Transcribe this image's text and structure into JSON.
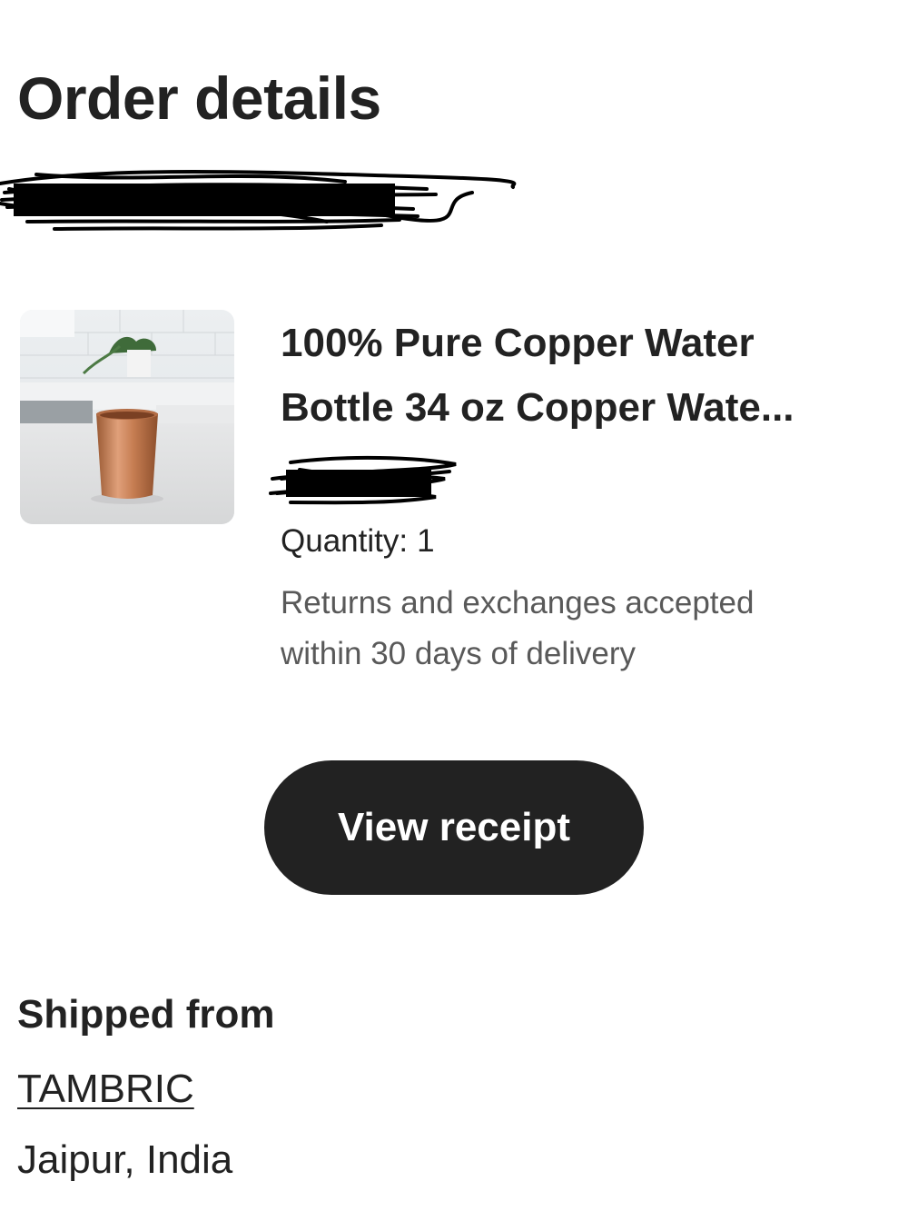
{
  "page": {
    "title": "Order details"
  },
  "item": {
    "title_line1": "100% Pure Copper Water",
    "title_line2": "Bottle 34 oz Copper Wate...",
    "quantity_label": "Quantity:",
    "quantity_value": "1",
    "returns_line1": "Returns and exchanges accepted",
    "returns_line2": "within 30 days of delivery"
  },
  "actions": {
    "view_receipt_label": "View receipt"
  },
  "shipping": {
    "heading": "Shipped from",
    "shop_name": "TAMBRIC",
    "location": "Jaipur, India"
  },
  "colors": {
    "text_primary": "#222222",
    "text_secondary": "#595959",
    "button_bg": "#222222",
    "button_text": "#ffffff",
    "copper": "#c8845a"
  },
  "icons": {
    "product_thumbnail": "copper-cup-photo"
  }
}
